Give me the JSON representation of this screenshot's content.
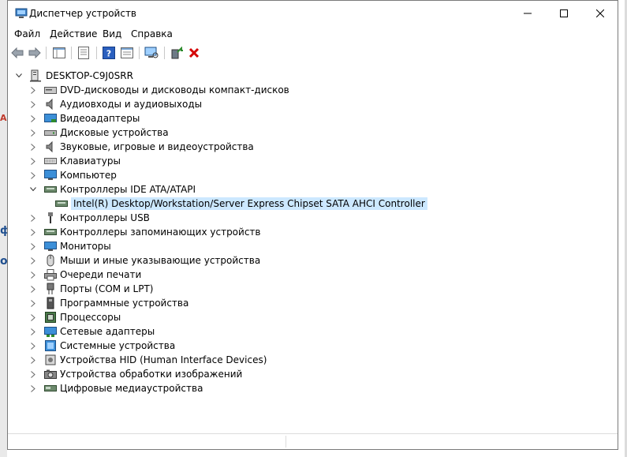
{
  "window": {
    "title": "Диспетчер устройств"
  },
  "menu": [
    "Файл",
    "Действие",
    "Вид",
    "Справка"
  ],
  "tree": {
    "root": "DESKTOP-C9J0SRR",
    "categories": [
      {
        "label": "DVD-дисководы и дисководы компакт-дисков",
        "icon": "dvd-drive-icon",
        "expanded": false
      },
      {
        "label": "Аудиовходы и аудиовыходы",
        "icon": "speaker-icon",
        "expanded": false
      },
      {
        "label": "Видеоадаптеры",
        "icon": "video-adapter-icon",
        "expanded": false
      },
      {
        "label": "Дисковые устройства",
        "icon": "disk-drive-icon",
        "expanded": false
      },
      {
        "label": "Звуковые, игровые и видеоустройства",
        "icon": "speaker-icon",
        "expanded": false
      },
      {
        "label": "Клавиатуры",
        "icon": "keyboard-icon",
        "expanded": false
      },
      {
        "label": "Компьютер",
        "icon": "computer-icon",
        "expanded": false
      },
      {
        "label": "Контроллеры IDE ATA/ATAPI",
        "icon": "ide-controller-icon",
        "expanded": true,
        "children": [
          "Intel(R) Desktop/Workstation/Server Express Chipset SATA AHCI Controller"
        ]
      },
      {
        "label": "Контроллеры USB",
        "icon": "usb-icon",
        "expanded": false
      },
      {
        "label": "Контроллеры запоминающих устройств",
        "icon": "storage-controller-icon",
        "expanded": false
      },
      {
        "label": "Мониторы",
        "icon": "monitor-icon",
        "expanded": false
      },
      {
        "label": "Мыши и иные указывающие устройства",
        "icon": "mouse-icon",
        "expanded": false
      },
      {
        "label": "Очереди печати",
        "icon": "printer-icon",
        "expanded": false
      },
      {
        "label": "Порты (COM и LPT)",
        "icon": "port-icon",
        "expanded": false
      },
      {
        "label": "Программные устройства",
        "icon": "software-device-icon",
        "expanded": false
      },
      {
        "label": "Процессоры",
        "icon": "processor-icon",
        "expanded": false
      },
      {
        "label": "Сетевые адаптеры",
        "icon": "network-adapter-icon",
        "expanded": false
      },
      {
        "label": "Системные устройства",
        "icon": "system-device-icon",
        "expanded": false
      },
      {
        "label": "Устройства HID (Human Interface Devices)",
        "icon": "hid-icon",
        "expanded": false
      },
      {
        "label": "Устройства обработки изображений",
        "icon": "camera-icon",
        "expanded": false
      },
      {
        "label": "Цифровые медиаустройства",
        "icon": "media-device-icon",
        "expanded": false
      }
    ]
  },
  "background_marks": [
    "А",
    "ф",
    "о"
  ],
  "colors": {
    "selection": "#cce8ff",
    "close_red": "#d40000",
    "accent_green": "#2e8b2e"
  }
}
